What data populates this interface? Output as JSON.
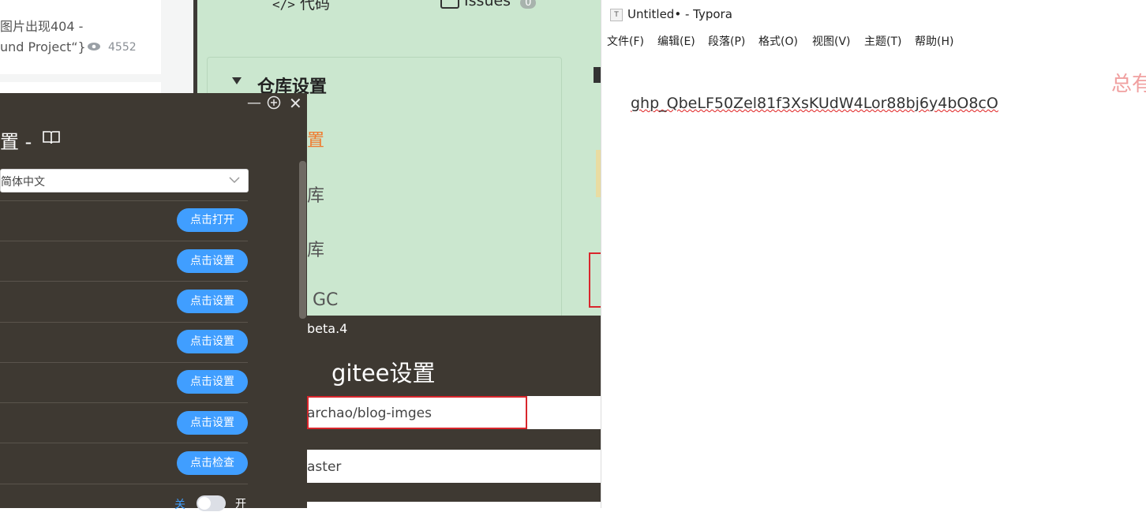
{
  "article": {
    "title_line1": "图片出现404 -",
    "title_line2": "und Project“}",
    "views": "4552"
  },
  "gitee_page": {
    "tab_code": "代码",
    "tab_issues": "Issues",
    "issues_count": "0",
    "section_title": "仓库设置",
    "menu_item_1": "置",
    "menu_item_2": "库",
    "menu_item_3": "库",
    "menu_item_4": "GC"
  },
  "picgo": {
    "title_fragment": "置 -",
    "language_value": "简体中文",
    "buttons": [
      "点击打开",
      "点击设置",
      "点击设置",
      "点击设置",
      "点击设置",
      "点击设置",
      "点击检查"
    ],
    "toggle_off": "关",
    "toggle_on": "开",
    "version_fragment": "beta.4"
  },
  "gitee_dialog": {
    "title": "gitee设置",
    "repo_value": "archao/blog-imges",
    "branch_value": "aster"
  },
  "typora": {
    "title": "Untitled• - Typora",
    "menus": [
      "文件(F)",
      "编辑(E)",
      "段落(P)",
      "格式(O)",
      "视图(V)",
      "主题(T)",
      "帮助(H)"
    ],
    "content": "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",
    "watermark": "总有"
  },
  "colors": {
    "accent_blue": "#409eff",
    "gitee_green": "#cbe7cf",
    "dark_panel": "#3e3932",
    "highlight_red": "#d9262c"
  }
}
